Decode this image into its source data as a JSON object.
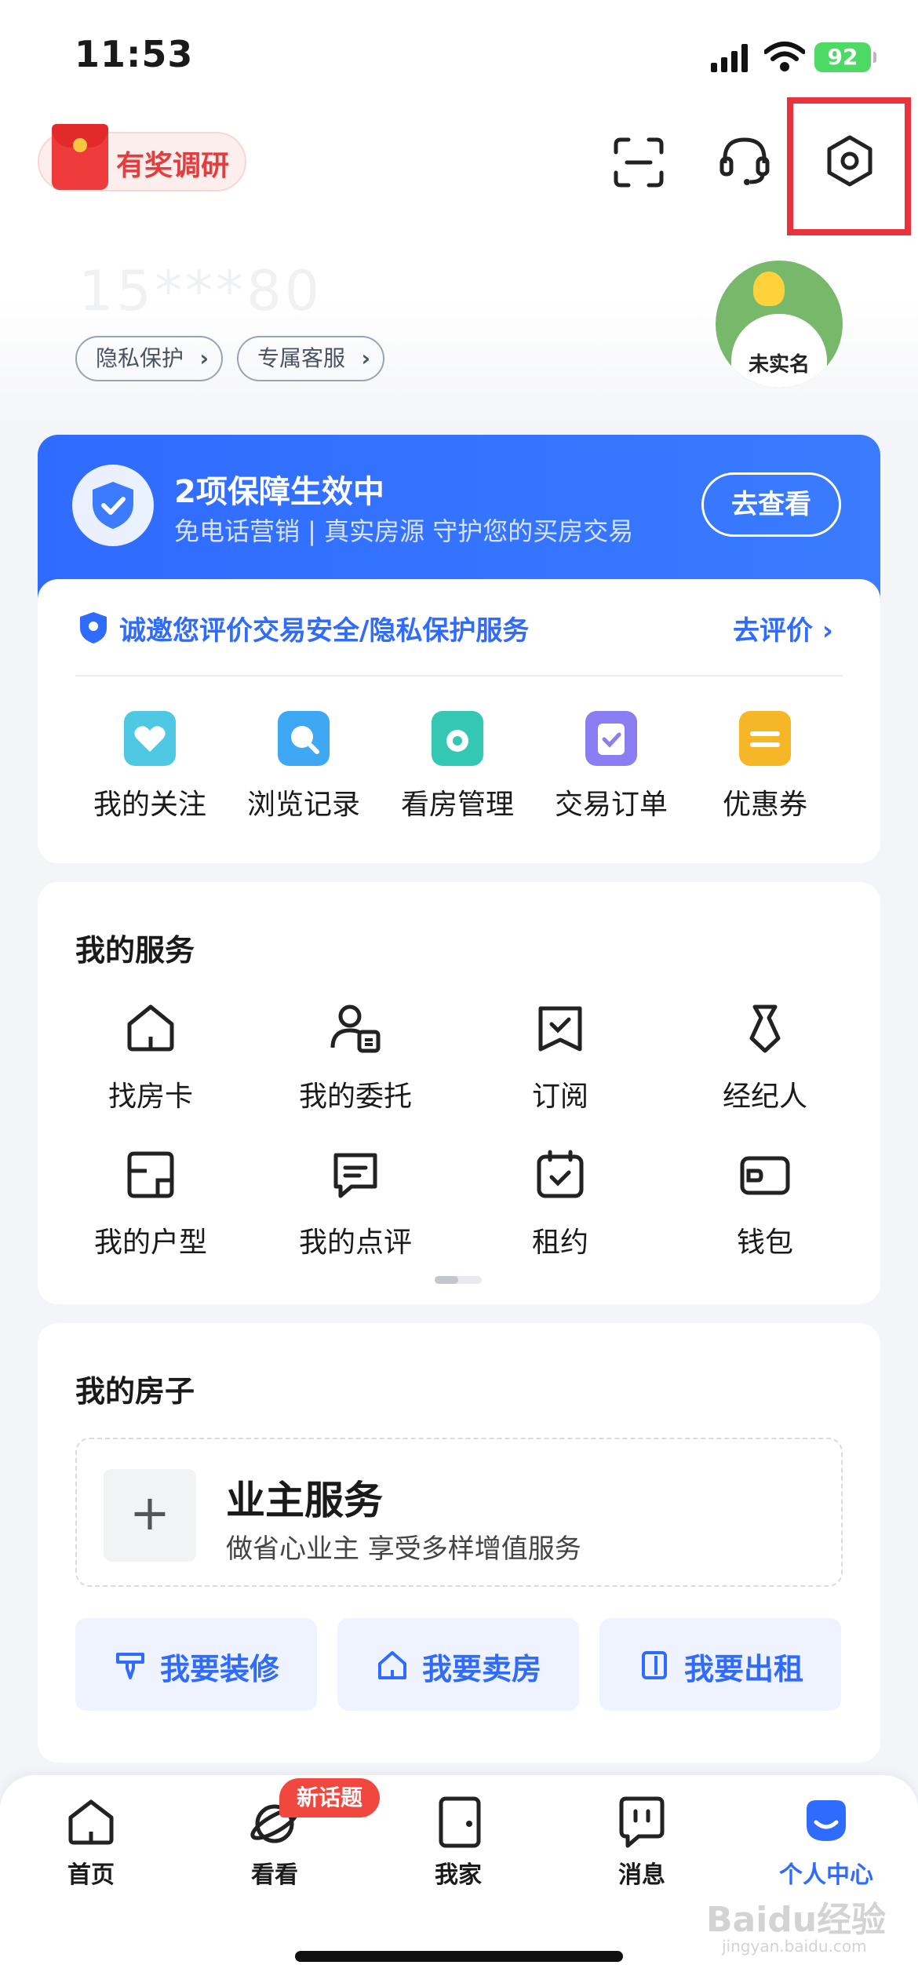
{
  "status_bar": {
    "time": "11:53",
    "battery": "92"
  },
  "header": {
    "survey_label": "有奖调研",
    "icons": [
      "scan-icon",
      "customer-service-icon",
      "settings-icon"
    ]
  },
  "profile": {
    "masked_phone": "15***80",
    "chips": [
      {
        "label": "隐私保护"
      },
      {
        "label": "专属客服"
      }
    ],
    "avatar_label": "未实名"
  },
  "guarantee": {
    "title": "2项保障生效中",
    "subtitle": "免电话营销 | 真实房源  守护您的买房交易",
    "button": "去查看"
  },
  "evaluation": {
    "text": "诚邀您评价交易安全/隐私保护服务",
    "link": "去评价"
  },
  "quick_items": [
    {
      "label": "我的关注",
      "icon": "heart-icon",
      "color": "#4fc9e3"
    },
    {
      "label": "浏览记录",
      "icon": "search-icon",
      "color": "#3fa8f5"
    },
    {
      "label": "看房管理",
      "icon": "camera-icon",
      "color": "#34c7b4"
    },
    {
      "label": "交易订单",
      "icon": "order-icon",
      "color": "#8b7df2"
    },
    {
      "label": "优惠券",
      "icon": "coupon-icon",
      "color": "#f5b728"
    }
  ],
  "services": {
    "title": "我的服务",
    "items": [
      {
        "label": "找房卡",
        "icon": "house-card-icon"
      },
      {
        "label": "我的委托",
        "icon": "entrust-icon"
      },
      {
        "label": "订阅",
        "icon": "subscribe-icon"
      },
      {
        "label": "经纪人",
        "icon": "agent-icon"
      },
      {
        "label": "我的户型",
        "icon": "floorplan-icon"
      },
      {
        "label": "我的点评",
        "icon": "review-icon"
      },
      {
        "label": "租约",
        "icon": "lease-icon"
      },
      {
        "label": "钱包",
        "icon": "wallet-icon"
      }
    ]
  },
  "house": {
    "title": "我的房子",
    "owner_title": "业主服务",
    "owner_subtitle": "做省心业主 享受多样增值服务",
    "actions": [
      {
        "label": "我要装修",
        "icon": "brush-icon"
      },
      {
        "label": "我要卖房",
        "icon": "house-icon"
      },
      {
        "label": "我要出租",
        "icon": "door-icon"
      }
    ]
  },
  "tabbar": {
    "badge": "新话题",
    "tabs": [
      {
        "label": "首页",
        "icon": "home-icon"
      },
      {
        "label": "看看",
        "icon": "planet-icon"
      },
      {
        "label": "我家",
        "icon": "door-icon"
      },
      {
        "label": "消息",
        "icon": "message-icon"
      },
      {
        "label": "个人中心",
        "icon": "smile-icon",
        "active": true
      }
    ]
  },
  "watermark": {
    "brand": "Baidu经验",
    "url": "jingyan.baidu.com"
  },
  "colors": {
    "accent": "#2f6bff",
    "danger": "#e8333c"
  }
}
